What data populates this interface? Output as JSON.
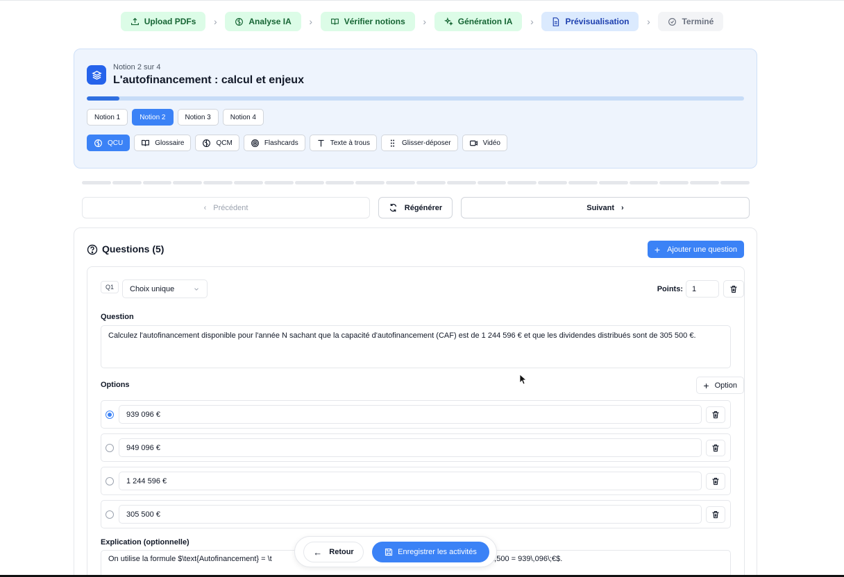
{
  "stepper": [
    {
      "label": "Upload PDFs",
      "status": "done",
      "icon": "upload-icon"
    },
    {
      "label": "Analyse IA",
      "status": "done",
      "icon": "brain-icon"
    },
    {
      "label": "Vérifier notions",
      "status": "done",
      "icon": "book-icon"
    },
    {
      "label": "Génération IA",
      "status": "done",
      "icon": "sparkles-icon"
    },
    {
      "label": "Prévisualisation",
      "status": "current",
      "icon": "file-icon"
    },
    {
      "label": "Terminé",
      "status": "todo",
      "icon": "check-circle-icon"
    }
  ],
  "notion": {
    "counter": "Notion 2 sur 4",
    "title": "L'autofinancement : calcul et enjeux",
    "progress": 0.05,
    "tabs": [
      "Notion 1",
      "Notion 2",
      "Notion 3",
      "Notion 4"
    ],
    "active_tab": 1
  },
  "activity_tabs": [
    {
      "label": "QCU",
      "icon": "brain-icon",
      "active": true
    },
    {
      "label": "Glossaire",
      "icon": "book-icon",
      "active": false
    },
    {
      "label": "QCM",
      "icon": "brain-icon",
      "active": false
    },
    {
      "label": "Flashcards",
      "icon": "target-icon",
      "active": false
    },
    {
      "label": "Texte à trous",
      "icon": "text-icon",
      "active": false
    },
    {
      "label": "Glisser-déposer",
      "icon": "grip-icon",
      "active": false
    },
    {
      "label": "Vidéo",
      "icon": "video-icon",
      "active": false
    }
  ],
  "nav": {
    "prev": "Précédent",
    "regen": "Régénérer",
    "next": "Suivant"
  },
  "questions": {
    "title": "Questions (5)",
    "add_label": "Ajouter une question",
    "item": {
      "badge": "Q1",
      "type": "Choix unique",
      "points_label": "Points:",
      "points_value": "1",
      "question_label": "Question",
      "question_text": "Calculez l'autofinancement disponible pour l'année N sachant que la capacité d'autofinancement (CAF) est de 1 244 596 € et que les dividendes distribués sont de 305 500 €.",
      "options_label": "Options",
      "add_option_label": "Option",
      "options": [
        {
          "value": "939 096 €",
          "checked": true
        },
        {
          "value": "949 096 €",
          "checked": false
        },
        {
          "value": "1 244 596 €",
          "checked": false
        },
        {
          "value": "305 500 €",
          "checked": false
        }
      ],
      "explanation_label": "Explication (optionnelle)",
      "explanation_left": "On utilise la formule $\\text{Autofinancement} = \\t",
      "explanation_right": "5\\,500 = 939\\,096\\;€$."
    }
  },
  "footer": {
    "back": "Retour",
    "save": "Enregistrer les activités"
  },
  "colors": {
    "accent": "#3b82f6",
    "done": "#dcfce7",
    "current": "#dbeafe"
  }
}
